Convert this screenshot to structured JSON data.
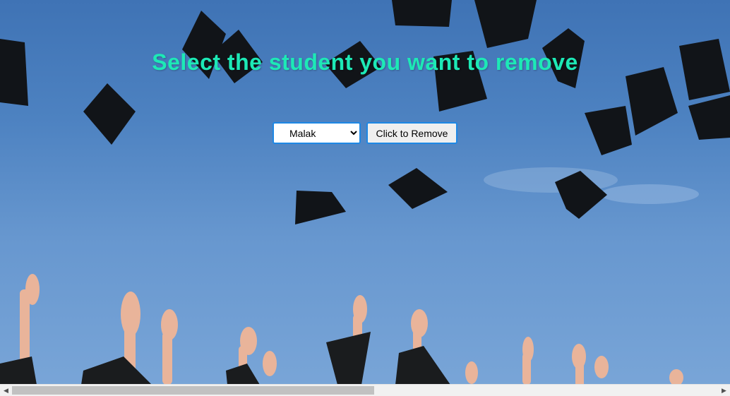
{
  "page": {
    "title": "Select the student you want to remove",
    "title_color": "#1de9b6"
  },
  "form": {
    "selected_student": "Malak",
    "students": [
      "Malak"
    ],
    "remove_button_label": "Click to Remove"
  },
  "background": {
    "description_icon": "graduation-caps-image",
    "sky_color": "#4d82c1"
  },
  "scrollbar": {
    "left_arrow": "◀",
    "right_arrow": "▶"
  }
}
